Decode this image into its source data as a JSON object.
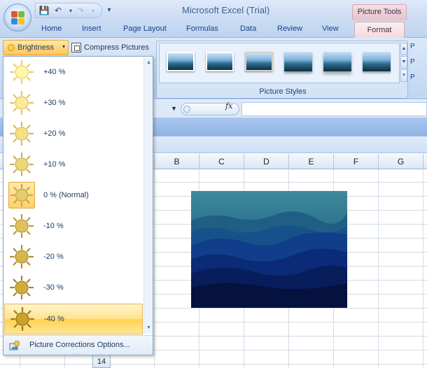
{
  "app": {
    "title": "Microsoft Excel (Trial)",
    "context_tab": "Picture Tools"
  },
  "qat": {
    "save": "💾",
    "undo": "↶",
    "redo": "↷",
    "customize": "▾"
  },
  "tabs": [
    "Home",
    "Insert",
    "Page Layout",
    "Formulas",
    "Data",
    "Review",
    "View"
  ],
  "active_tab": "Format",
  "ribbon": {
    "brightness_label": "Brightness",
    "compress_label": "Compress Pictures",
    "picture_styles_label": "Picture Styles",
    "side_buttons": [
      "P",
      "P",
      "P"
    ]
  },
  "formula_bar": {
    "fx": "fx",
    "value": ""
  },
  "columns": [
    "B",
    "C",
    "D",
    "E",
    "F",
    "G"
  ],
  "row_header": "14",
  "brightness_menu": {
    "options": [
      {
        "label": "+40 %",
        "level": 0.4
      },
      {
        "label": "+30 %",
        "level": 0.3
      },
      {
        "label": "+20 %",
        "level": 0.2
      },
      {
        "label": "+10 %",
        "level": 0.1
      },
      {
        "label": "0 % (Normal)",
        "level": 0.0,
        "selected": true
      },
      {
        "label": "-10 %",
        "level": -0.1
      },
      {
        "label": "-20 %",
        "level": -0.2
      },
      {
        "label": "-30 %",
        "level": -0.3
      },
      {
        "label": "-40 %",
        "level": -0.4,
        "hovered": true
      }
    ],
    "footer": "Picture Corrections Options..."
  }
}
